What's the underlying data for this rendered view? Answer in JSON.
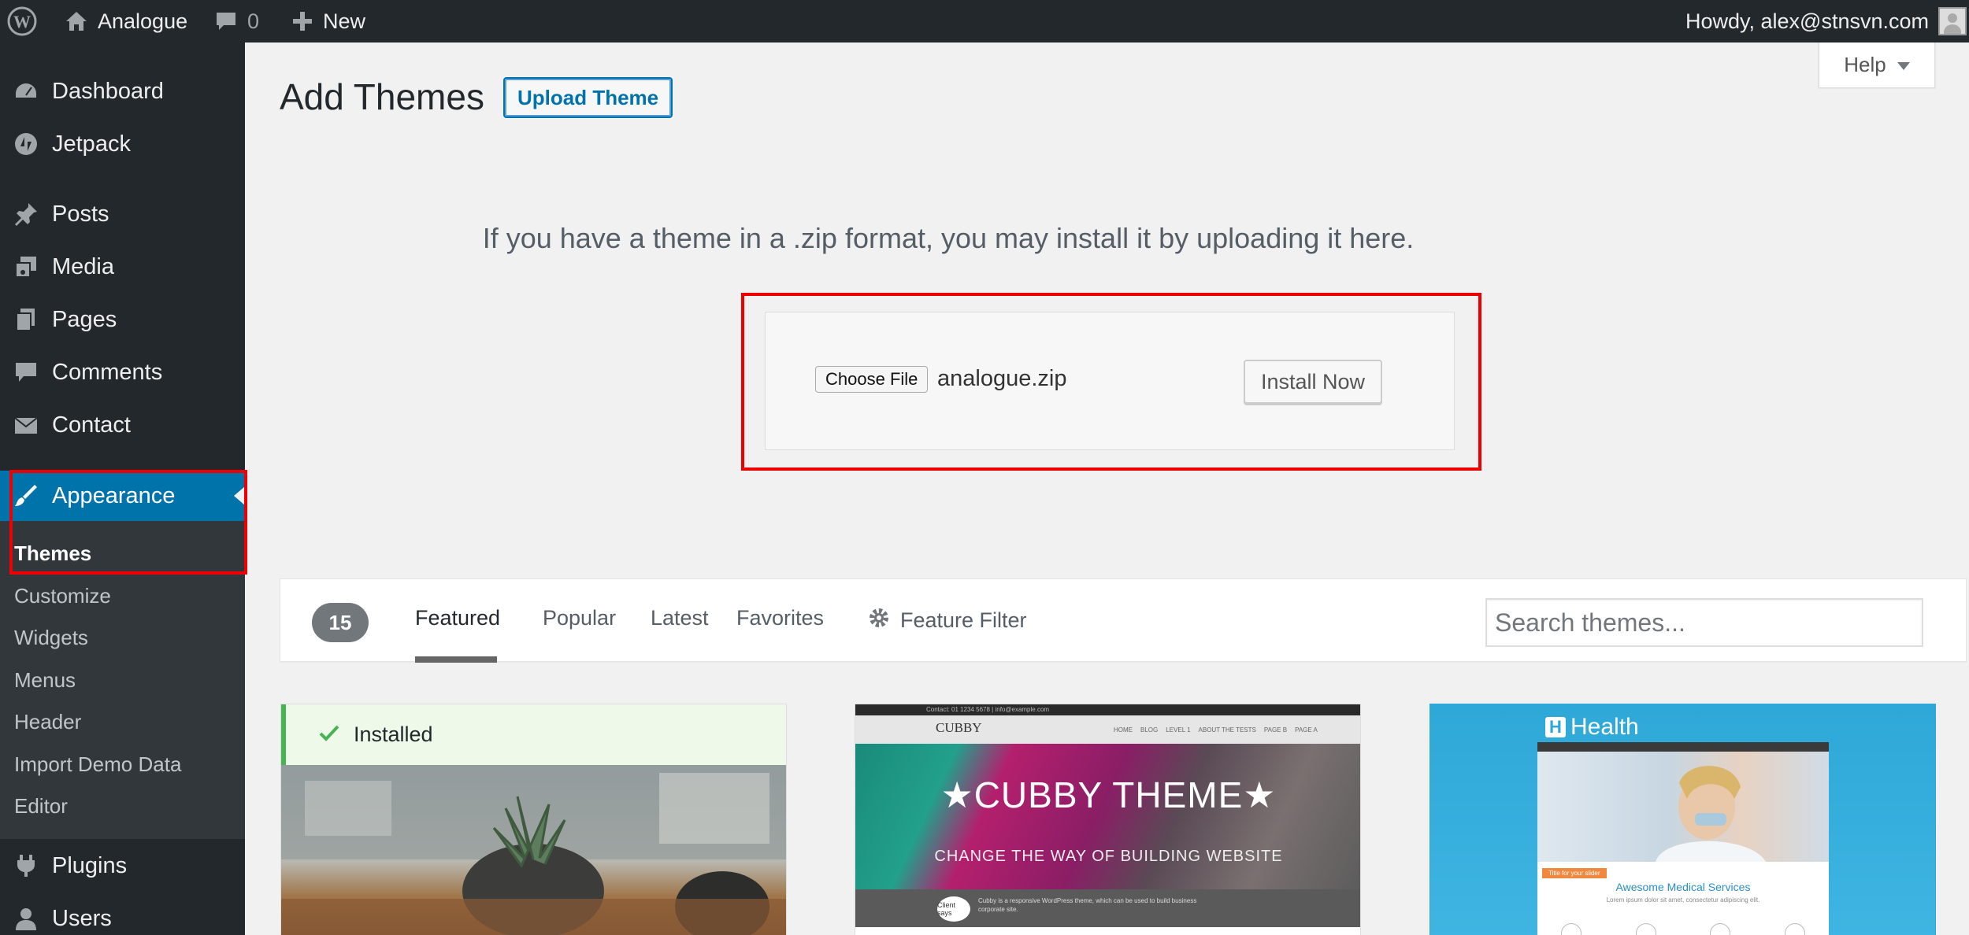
{
  "admin_bar": {
    "site_name": "Analogue",
    "comments_count": "0",
    "new_label": "New",
    "greeting": "Howdy, alex@stnsvn.com"
  },
  "sidebar": {
    "items": [
      {
        "label": "Dashboard",
        "icon": "dashboard-icon"
      },
      {
        "label": "Jetpack",
        "icon": "jetpack-icon"
      },
      {
        "label": "Posts",
        "icon": "pin-icon"
      },
      {
        "label": "Media",
        "icon": "media-icon"
      },
      {
        "label": "Pages",
        "icon": "pages-icon"
      },
      {
        "label": "Comments",
        "icon": "comment-icon"
      },
      {
        "label": "Contact",
        "icon": "envelope-icon"
      },
      {
        "label": "Appearance",
        "icon": "brush-icon"
      },
      {
        "label": "Plugins",
        "icon": "plug-icon"
      },
      {
        "label": "Users",
        "icon": "user-icon"
      }
    ],
    "submenu": [
      "Themes",
      "Customize",
      "Widgets",
      "Menus",
      "Header",
      "Import Demo Data",
      "Editor"
    ]
  },
  "header": {
    "title": "Add Themes",
    "upload_button": "Upload Theme",
    "help_label": "Help"
  },
  "upload": {
    "instruction": "If you have a theme in a .zip format, you may install it by uploading it here.",
    "choose_file_label": "Choose File",
    "file_name": "analogue.zip",
    "install_button": "Install Now"
  },
  "filter_bar": {
    "count": "15",
    "tabs": [
      "Featured",
      "Popular",
      "Latest",
      "Favorites"
    ],
    "feature_filter": "Feature Filter",
    "search_placeholder": "Search themes..."
  },
  "themes": {
    "installed_label": "Installed",
    "cubby": {
      "topbar": "Contact: 01 1234 5678  |  info@example.com",
      "logo": "CUBBY",
      "menu": [
        "HOME",
        "BLOG",
        "LEVEL 1",
        "ABOUT THE TESTS",
        "PAGE B",
        "PAGE A"
      ],
      "title": "★CUBBY THEME★",
      "subtitle": "CHANGE THE WAY OF BUILDING WEBSITE",
      "bubble": "Client says",
      "quote": "Cubby is a responsive WordPress theme, which can be used to build business corporate site."
    },
    "health": {
      "logo": "Health",
      "tag": "Title for your slider",
      "heading": "Awesome Medical Services",
      "lorem": "Lorem ipsum dolor sit amet, consectetur adipiscing elit."
    }
  },
  "colors": {
    "admin_bg": "#23282d",
    "accent": "#0073aa",
    "highlight_box": "#ee0000",
    "installed_green": "#46b450"
  }
}
